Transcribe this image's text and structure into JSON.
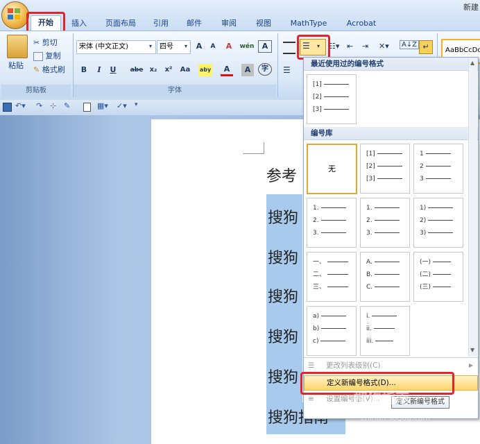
{
  "window": {
    "title": "新建"
  },
  "tabs": [
    "开始",
    "插入",
    "页面布局",
    "引用",
    "邮件",
    "审阅",
    "视图",
    "MathType",
    "Acrobat"
  ],
  "clipboard": {
    "paste": "粘贴",
    "cut": "剪切",
    "copy": "复制",
    "format_painter": "格式刷",
    "label": "剪贴板"
  },
  "font": {
    "name": "宋体 (中文正文)",
    "size": "四号",
    "label": "字体",
    "bold": "B",
    "italic": "I",
    "underline": "U",
    "strike": "abe",
    "sub": "x₂",
    "sup": "x²",
    "case": "Aa",
    "grow": "A",
    "shrink": "A",
    "clear": "A",
    "phonetic": "wén",
    "border_char": "A",
    "highlight": "aby",
    "font_color": "A",
    "enclose": "字"
  },
  "styles": {
    "preview": "AaBbCcDc"
  },
  "document": {
    "heading": "参考",
    "lines": [
      "搜狗",
      "搜狗",
      "搜狗",
      "搜狗",
      "搜狗",
      "搜狗指南"
    ],
    "last_suffix": "↵"
  },
  "dropdown": {
    "recent_header": "最近使用过的编号格式",
    "recent": [
      [
        "[1]",
        "[2]",
        "[3]"
      ]
    ],
    "library_header": "编号库",
    "none_label": "无",
    "library": [
      [
        "[1]",
        "[2]",
        "[3]"
      ],
      [
        "1",
        "2",
        "3"
      ],
      [
        "1.",
        "2.",
        "3."
      ],
      [
        "1.",
        "2.",
        "3."
      ],
      [
        "1)",
        "2)",
        "3)"
      ],
      [
        "一、",
        "二、",
        "三、"
      ],
      [
        "A.",
        "B.",
        "C."
      ],
      [
        "(一)",
        "(二)",
        "(三)"
      ],
      [
        "a)",
        "b)",
        "c)"
      ],
      [
        "i.",
        "ii.",
        "iii."
      ]
    ],
    "change_level": "更改列表级别(C)",
    "define_new": "定义新编号格式(D)...",
    "set_value": "设置编号值(V)...",
    "tooltip": "定义新编号格式"
  },
  "watermark": {
    "brand": "搜狗指南",
    "url": "zhinan.sogou.com"
  }
}
